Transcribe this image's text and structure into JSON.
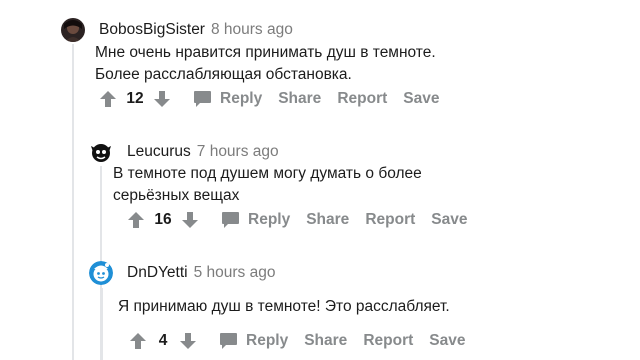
{
  "comments": [
    {
      "author": "BobosBigSister",
      "time": "8 hours ago",
      "body_lines": [
        "Мне очень нравится принимать душ в темноте.",
        "Более расслабляющая обстановка."
      ],
      "score": "12",
      "actions": {
        "reply": "Reply",
        "share": "Share",
        "report": "Report",
        "save": "Save"
      }
    },
    {
      "author": "Leucurus",
      "time": "7 hours ago",
      "body_lines": [
        "В темноте под душем могу думать о более",
        "серьёзных вещах"
      ],
      "score": "16",
      "actions": {
        "reply": "Reply",
        "share": "Share",
        "report": "Report",
        "save": "Save"
      }
    },
    {
      "author": "DnDYetti",
      "time": "5 hours ago",
      "body_lines": [
        "Я принимаю душ в темноте! Это расслабляет."
      ],
      "score": "4",
      "actions": {
        "reply": "Reply",
        "share": "Share",
        "report": "Report",
        "save": "Save"
      }
    }
  ],
  "colors": {
    "text": "#1c1c1c",
    "meta": "#7c7c7c",
    "action": "#878a8c",
    "icon": "#878a8c",
    "thread_line": "#e3e5e8"
  }
}
